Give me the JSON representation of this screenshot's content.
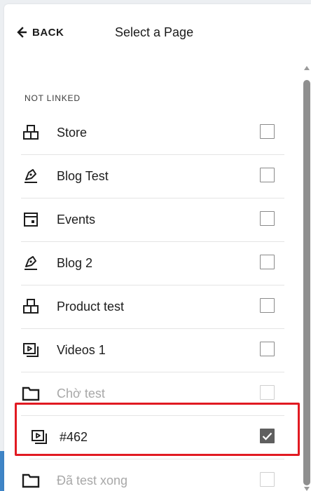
{
  "header": {
    "back_label": "BACK",
    "title": "Select a Page"
  },
  "section": {
    "label": "NOT LINKED"
  },
  "pages": [
    {
      "label": "Store",
      "icon": "store-icon",
      "checked": false,
      "disabled": false
    },
    {
      "label": "Blog Test",
      "icon": "blog-icon",
      "checked": false,
      "disabled": false
    },
    {
      "label": "Events",
      "icon": "events-icon",
      "checked": false,
      "disabled": false
    },
    {
      "label": "Blog 2",
      "icon": "blog-icon",
      "checked": false,
      "disabled": false
    },
    {
      "label": "Product test",
      "icon": "store-icon",
      "checked": false,
      "disabled": false
    },
    {
      "label": "Videos 1",
      "icon": "video-icon",
      "checked": false,
      "disabled": false
    },
    {
      "label": "Chờ test",
      "icon": "folder-icon",
      "checked": false,
      "disabled": true
    },
    {
      "label": "#462",
      "icon": "video-icon",
      "checked": true,
      "disabled": false
    },
    {
      "label": "Đã test xong",
      "icon": "folder-icon",
      "checked": false,
      "disabled": true
    }
  ],
  "colors": {
    "highlight": "#e11a22",
    "checkbox_checked": "#5f5f5f",
    "disabled_text": "#a8a8a8",
    "accent_strip": "#3f85c7"
  }
}
